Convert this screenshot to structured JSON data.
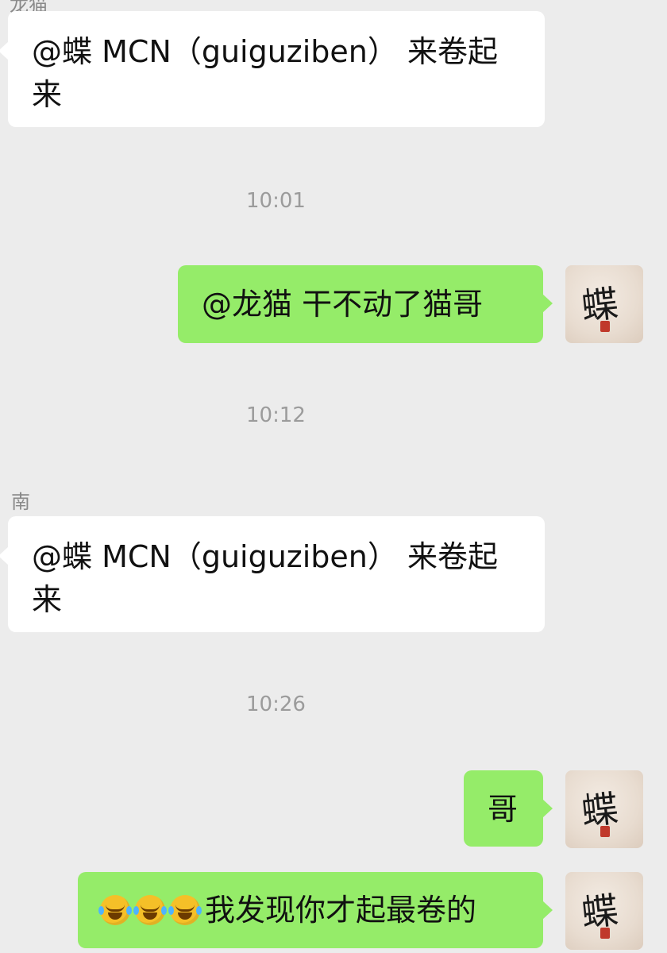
{
  "messages": [
    {
      "type": "sender",
      "text": "龙猫"
    },
    {
      "type": "left",
      "text": "@蝶 MCN（guiguziben） 来卷起来"
    },
    {
      "type": "time",
      "text": "10:01"
    },
    {
      "type": "right",
      "text": "@龙猫 干不动了猫哥"
    },
    {
      "type": "time",
      "text": "10:12"
    },
    {
      "type": "sender",
      "text": "南"
    },
    {
      "type": "left",
      "text": "@蝶 MCN（guiguziben） 来卷起来"
    },
    {
      "type": "time",
      "text": "10:26"
    },
    {
      "type": "right",
      "text": "哥"
    },
    {
      "type": "right",
      "text": "我发现你才起最卷的",
      "emoji_prefix": [
        "crying-laughing",
        "crying-laughing",
        "crying-laughing"
      ]
    }
  ],
  "avatar": {
    "glyph": "蝶",
    "icon": "calligraphy-butterfly-avatar"
  },
  "colors": {
    "background": "#ececec",
    "incoming": "#ffffff",
    "outgoing": "#95ec69",
    "timestamp": "#9b9b9b"
  }
}
